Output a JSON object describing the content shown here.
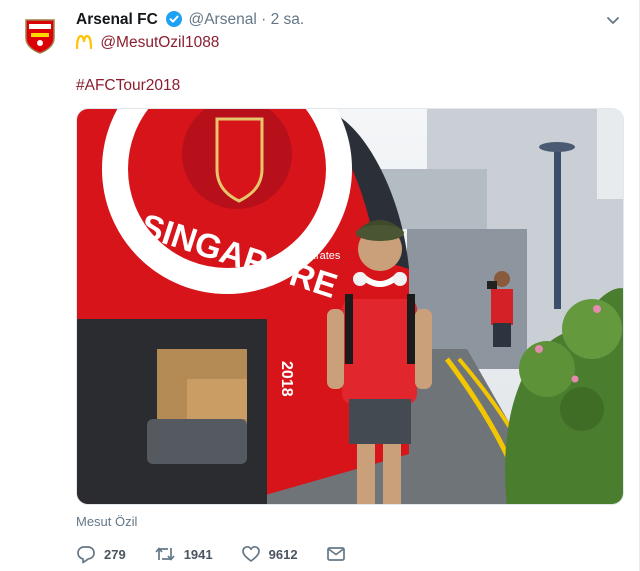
{
  "tweet": {
    "display_name": "Arsenal FC",
    "handle": "@Arsenal",
    "separator": "·",
    "time": "2 sa.",
    "mention": "@MesutOzil1088",
    "hashtag": "#AFCTour2018",
    "tagged_person": "Mesut Özil",
    "accent_color": "#8b1f2f",
    "verified_color": "#1da1f2"
  },
  "photo": {
    "bus_text": "SINGAPORE",
    "bus_number": "2018",
    "sponsor": "Emirates"
  },
  "actions": {
    "replies": "279",
    "retweets": "1941",
    "likes": "9612",
    "icons": [
      "reply-icon",
      "retweet-icon",
      "like-icon",
      "direct-message-icon"
    ]
  }
}
